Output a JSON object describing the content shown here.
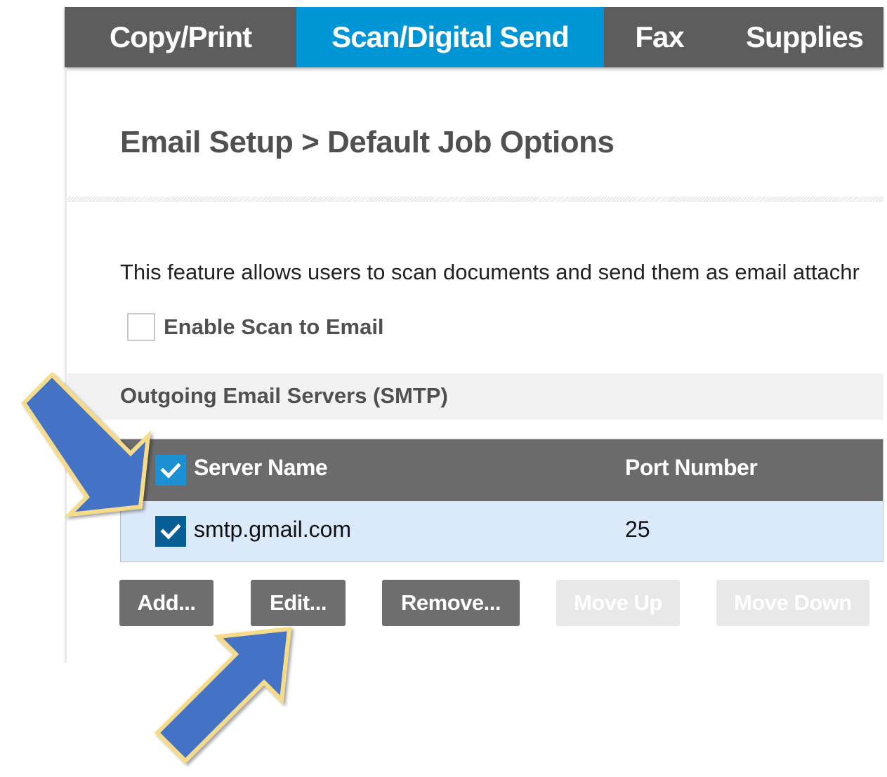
{
  "nav": {
    "tabs": [
      {
        "label": "Copy/Print",
        "active": false
      },
      {
        "label": "Scan/Digital Send",
        "active": true
      },
      {
        "label": "Fax",
        "active": false
      },
      {
        "label": "Supplies",
        "active": false
      }
    ]
  },
  "page": {
    "title": "Email Setup > Default Job Options",
    "description": "This feature allows users to scan documents and send them as email attachr",
    "enable_label": "Enable Scan to Email",
    "enable_checked": false
  },
  "smtp": {
    "section_title": "Outgoing Email Servers (SMTP)",
    "columns": [
      "Server Name",
      "Port Number"
    ],
    "header_checked": true,
    "rows": [
      {
        "server": "smtp.gmail.com",
        "port": "25",
        "checked": true
      }
    ]
  },
  "buttons": {
    "add": "Add...",
    "edit": "Edit...",
    "remove": "Remove...",
    "move_up": "Move Up",
    "move_down": "Move Down"
  },
  "colors": {
    "nav_background": "#5d5d5d",
    "nav_active": "#0096d6",
    "table_header": "#6b6b6b",
    "selected_row": "#dbeafb",
    "checkbox_blue": "#0a6aa8",
    "button_gray": "#6e6e6e",
    "callout_arrow": "#4472c4",
    "callout_outline": "#f6dc8a"
  },
  "annotations": [
    "callout-arrow-server-checkbox",
    "callout-arrow-edit-button"
  ]
}
